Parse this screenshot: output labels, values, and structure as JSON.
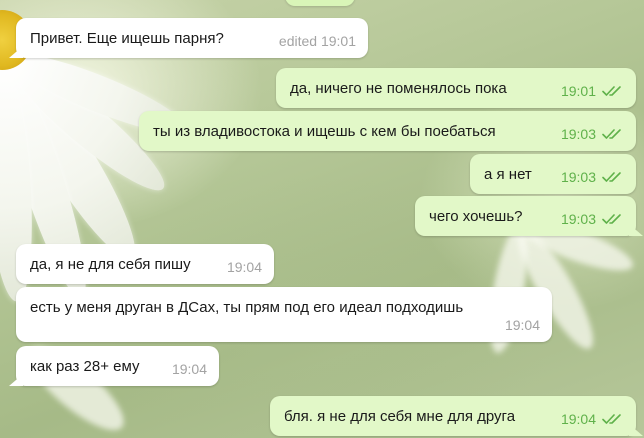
{
  "colors": {
    "incoming_bubble": "#ffffff",
    "outgoing_bubble": "#e2f8c8",
    "incoming_time": "#a3a3a3",
    "outgoing_time": "#5fb14a",
    "read_ticks": "#5fb14a"
  },
  "messages": [
    {
      "direction": "in",
      "text": "Привет. Еще ищешь парня?",
      "time": "edited 19:01"
    },
    {
      "direction": "out",
      "text": "да, ничего не поменялось пока",
      "time": "19:01",
      "status_icon": "double-check-icon"
    },
    {
      "direction": "out",
      "text": "ты из владивостока и ищешь с кем бы поебаться",
      "time": "19:03",
      "status_icon": "double-check-icon"
    },
    {
      "direction": "out",
      "text": "а я нет",
      "time": "19:03",
      "status_icon": "double-check-icon"
    },
    {
      "direction": "out",
      "text": "чего хочешь?",
      "time": "19:03",
      "status_icon": "double-check-icon"
    },
    {
      "direction": "in",
      "text": "да, я не для себя пишу",
      "time": "19:04"
    },
    {
      "direction": "in",
      "text": "есть у меня друган в ДСах, ты прям под его идеал подходишь",
      "time": "19:04"
    },
    {
      "direction": "in",
      "text": "как раз 28+ ему",
      "time": "19:04"
    },
    {
      "direction": "out",
      "text": "бля. я не для себя мне для друга",
      "time": "19:04",
      "status_icon": "double-check-icon"
    }
  ]
}
